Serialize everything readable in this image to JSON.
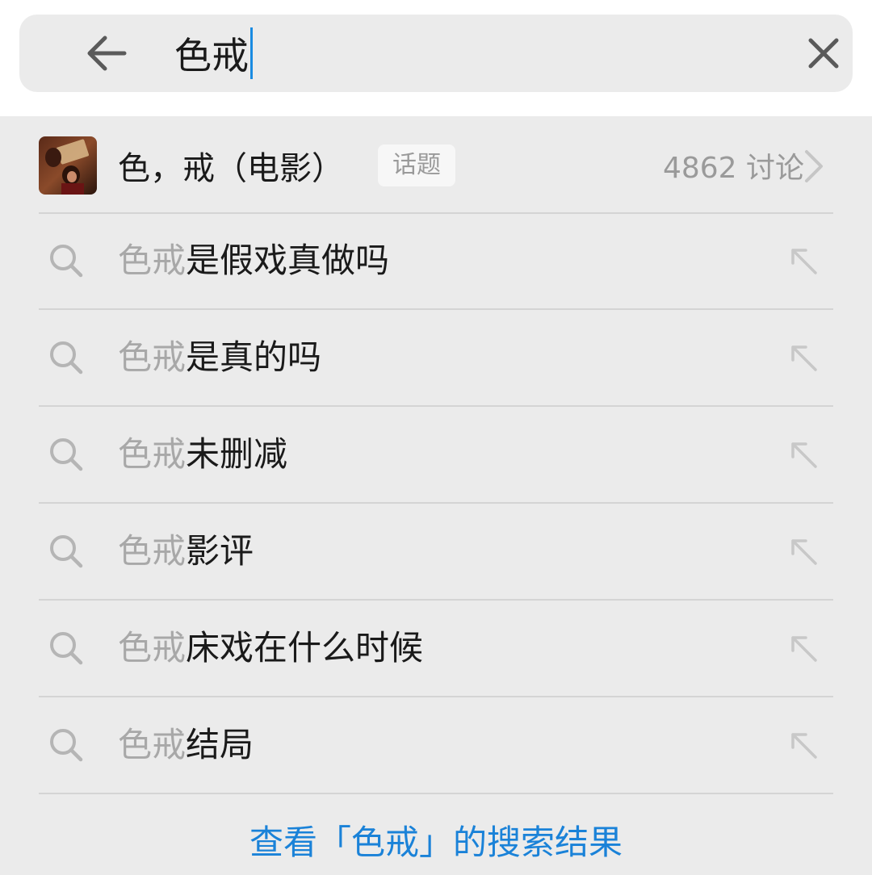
{
  "search": {
    "query": "色戒"
  },
  "topic": {
    "title": "色，戒（电影）",
    "badge": "话题",
    "count": "4862 讨论"
  },
  "suggestions": [
    {
      "match": "色戒",
      "rest": "是假戏真做吗"
    },
    {
      "match": "色戒",
      "rest": "是真的吗"
    },
    {
      "match": "色戒",
      "rest": "未删减"
    },
    {
      "match": "色戒",
      "rest": "影评"
    },
    {
      "match": "色戒",
      "rest": "床戏在什么时候"
    },
    {
      "match": "色戒",
      "rest": "结局"
    }
  ],
  "view_all": "查看「色戒」的搜索结果",
  "colors": {
    "accent": "#1a82d8",
    "cursor": "#1a8be2",
    "text": "#1a1a1a",
    "muted": "#9a9a9a",
    "background": "#ebebeb"
  },
  "icons": {
    "back": "arrow-left-icon",
    "clear": "close-icon",
    "search": "search-icon",
    "fill": "arrow-up-left-icon",
    "chevron": "chevron-right-icon"
  }
}
